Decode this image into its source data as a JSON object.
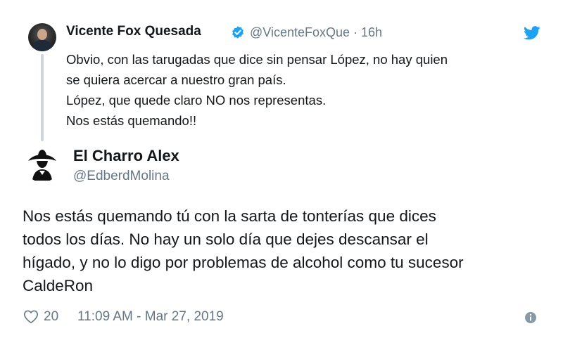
{
  "colors": {
    "text": "#14171a",
    "secondary": "#657786",
    "twitter_blue": "#1da1f2",
    "thread_line": "#ccd6dd"
  },
  "parent_tweet": {
    "name": "Vicente Fox Quesada",
    "handle_time": "@VicenteFoxQue · 16h",
    "lines": [
      "Obvio, con las tarugadas que dice sin pensar López,  no hay quien",
      "se quiera acercar a nuestro gran país.",
      "López, que quede claro NO nos representas.",
      "Nos estás quemando!!"
    ],
    "icons": [
      "avatar",
      "verified-badge-icon",
      "twitter-bird-icon"
    ]
  },
  "reply_tweet": {
    "name": "El Charro Alex",
    "handle": "@EdberdMolina",
    "lines": [
      "Nos estás quemando tú con la sarta de tonterías que dices",
      "todos los días. No hay un solo día que dejes descansar el",
      "hígado, y no lo digo por problemas de alcohol como tu sucesor",
      "CaldeRon"
    ],
    "like_count": "20",
    "timestamp": "11:09 AM - Mar 27, 2019",
    "icons": [
      "avatar",
      "heart-icon",
      "info-icon"
    ]
  }
}
